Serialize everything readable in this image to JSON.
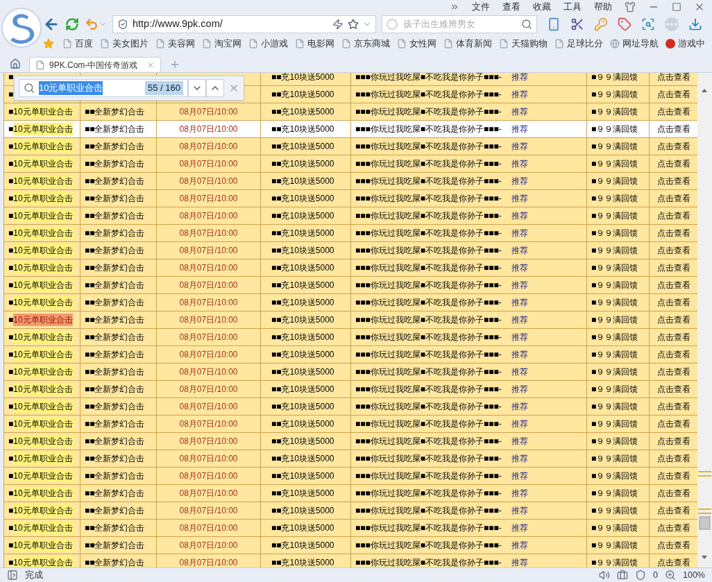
{
  "menu": [
    "文件",
    "查看",
    "收藏",
    "工具",
    "帮助"
  ],
  "address": {
    "url": "http://www.9pk.com/"
  },
  "search": {
    "placeholder": "孩子出生难辨男女"
  },
  "bookmarks": [
    {
      "label": "百度",
      "kind": "page"
    },
    {
      "label": "美女图片",
      "kind": "page"
    },
    {
      "label": "美容网",
      "kind": "page"
    },
    {
      "label": "淘宝网",
      "kind": "page"
    },
    {
      "label": "小游戏",
      "kind": "page"
    },
    {
      "label": "电影网",
      "kind": "page"
    },
    {
      "label": "京东商城",
      "kind": "page"
    },
    {
      "label": "女性网",
      "kind": "page"
    },
    {
      "label": "体育新闻",
      "kind": "page"
    },
    {
      "label": "天猫购物",
      "kind": "page"
    },
    {
      "label": "足球比分",
      "kind": "page"
    },
    {
      "label": "网址导航",
      "kind": "globe"
    },
    {
      "label": "游戏中",
      "kind": "game"
    }
  ],
  "tabs": [
    {
      "title": "9PK.Com-中国传奇游戏",
      "selected": true
    }
  ],
  "find_bar": {
    "query": "10元单职业合击",
    "count": "55 / 160"
  },
  "rows": [
    {
      "cells": [
        "■",
        null,
        null,
        null,
        "■■充10块送5000",
        "■■■你玩过我吃屎■不吃我是你孙子■■■-",
        "推荐",
        "■９９满回馈",
        "点击查看"
      ],
      "hovered": false
    },
    {
      "cells": [
        "■",
        null,
        null,
        null,
        "■■充10块送5000",
        "■■■你玩过我吃屎■不吃我是你孙子■■■-",
        "推荐",
        "■９９满回馈",
        "点击查看"
      ],
      "hovered": false
    },
    {
      "cells": [
        "■",
        "10元单职业合击",
        "■■全新梦幻合击",
        "08月07日/10:00",
        "■■充10块送5000",
        "■■■你玩过我吃屎■不吃我是你孙子■■■-",
        "推荐",
        "■９９满回馈",
        "点击查看"
      ],
      "hovered": false,
      "current_match": false
    },
    {
      "cells": [
        "■",
        "10元单职业合击",
        "■■全新梦幻合击",
        "08月07日/10:00",
        "■■充10块送5000",
        "■■■你玩过我吃屎■不吃我是你孙子■■■-",
        "推荐",
        "■９９满回馈",
        "点击查看"
      ],
      "hovered": true,
      "current_match": false
    },
    {
      "cells": [
        "■",
        "10元单职业合击",
        "■■全新梦幻合击",
        "08月07日/10:00",
        "■■充10块送5000",
        "■■■你玩过我吃屎■不吃我是你孙子■■■-",
        "推荐",
        "■９９满回馈",
        "点击查看"
      ],
      "hovered": false,
      "current_match": false
    },
    {
      "cells": [
        "■",
        "10元单职业合击",
        "■■全新梦幻合击",
        "08月07日/10:00",
        "■■充10块送5000",
        "■■■你玩过我吃屎■不吃我是你孙子■■■-",
        "推荐",
        "■９９满回馈",
        "点击查看"
      ],
      "hovered": false,
      "current_match": false
    },
    {
      "cells": [
        "■",
        "10元单职业合击",
        "■■全新梦幻合击",
        "08月07日/10:00",
        "■■充10块送5000",
        "■■■你玩过我吃屎■不吃我是你孙子■■■-",
        "推荐",
        "■９９满回馈",
        "点击查看"
      ],
      "hovered": false,
      "current_match": false
    },
    {
      "cells": [
        "■",
        "10元单职业合击",
        "■■全新梦幻合击",
        "08月07日/10:00",
        "■■充10块送5000",
        "■■■你玩过我吃屎■不吃我是你孙子■■■-",
        "推荐",
        "■９９满回馈",
        "点击查看"
      ],
      "hovered": false,
      "current_match": false
    },
    {
      "cells": [
        "■",
        "10元单职业合击",
        "■■全新梦幻合击",
        "08月07日/10:00",
        "■■充10块送5000",
        "■■■你玩过我吃屎■不吃我是你孙子■■■-",
        "推荐",
        "■９９满回馈",
        "点击查看"
      ],
      "hovered": false,
      "current_match": false
    },
    {
      "cells": [
        "■",
        "10元单职业合击",
        "■■全新梦幻合击",
        "08月07日/10:00",
        "■■充10块送5000",
        "■■■你玩过我吃屎■不吃我是你孙子■■■-",
        "推荐",
        "■９９满回馈",
        "点击查看"
      ],
      "hovered": false,
      "current_match": false
    },
    {
      "cells": [
        "■",
        "10元单职业合击",
        "■■全新梦幻合击",
        "08月07日/10:00",
        "■■充10块送5000",
        "■■■你玩过我吃屎■不吃我是你孙子■■■-",
        "推荐",
        "■９９满回馈",
        "点击查看"
      ],
      "hovered": false,
      "current_match": false
    },
    {
      "cells": [
        "■",
        "10元单职业合击",
        "■■全新梦幻合击",
        "08月07日/10:00",
        "■■充10块送5000",
        "■■■你玩过我吃屎■不吃我是你孙子■■■-",
        "推荐",
        "■９９满回馈",
        "点击查看"
      ],
      "hovered": false,
      "current_match": false
    },
    {
      "cells": [
        "■",
        "10元单职业合击",
        "■■全新梦幻合击",
        "08月07日/10:00",
        "■■充10块送5000",
        "■■■你玩过我吃屎■不吃我是你孙子■■■-",
        "推荐",
        "■９９满回馈",
        "点击查看"
      ],
      "hovered": false,
      "current_match": false
    },
    {
      "cells": [
        "■",
        "10元单职业合击",
        "■■全新梦幻合击",
        "08月07日/10:00",
        "■■充10块送5000",
        "■■■你玩过我吃屎■不吃我是你孙子■■■-",
        "推荐",
        "■９９满回馈",
        "点击查看"
      ],
      "hovered": false,
      "current_match": false
    },
    {
      "cells": [
        "■",
        "10元单职业合击",
        "■■全新梦幻合击",
        "08月07日/10:00",
        "■■充10块送5000",
        "■■■你玩过我吃屎■不吃我是你孙子■■■-",
        "推荐",
        "■９９满回馈",
        "点击查看"
      ],
      "hovered": false,
      "current_match": true
    },
    {
      "cells": [
        "■",
        "10元单职业合击",
        "■■全新梦幻合击",
        "08月07日/10:00",
        "■■充10块送5000",
        "■■■你玩过我吃屎■不吃我是你孙子■■■-",
        "推荐",
        "■９９满回馈",
        "点击查看"
      ],
      "hovered": false,
      "current_match": false
    },
    {
      "cells": [
        "■",
        "10元单职业合击",
        "■■全新梦幻合击",
        "08月07日/10:00",
        "■■充10块送5000",
        "■■■你玩过我吃屎■不吃我是你孙子■■■-",
        "推荐",
        "■９９满回馈",
        "点击查看"
      ],
      "hovered": false,
      "current_match": false
    },
    {
      "cells": [
        "■",
        "10元单职业合击",
        "■■全新梦幻合击",
        "08月07日/10:00",
        "■■充10块送5000",
        "■■■你玩过我吃屎■不吃我是你孙子■■■-",
        "推荐",
        "■９９满回馈",
        "点击查看"
      ],
      "hovered": false,
      "current_match": false
    },
    {
      "cells": [
        "■",
        "10元单职业合击",
        "■■全新梦幻合击",
        "08月07日/10:00",
        "■■充10块送5000",
        "■■■你玩过我吃屎■不吃我是你孙子■■■-",
        "推荐",
        "■９９满回馈",
        "点击查看"
      ],
      "hovered": false,
      "current_match": false
    },
    {
      "cells": [
        "■",
        "10元单职业合击",
        "■■全新梦幻合击",
        "08月07日/10:00",
        "■■充10块送5000",
        "■■■你玩过我吃屎■不吃我是你孙子■■■-",
        "推荐",
        "■９９满回馈",
        "点击查看"
      ],
      "hovered": false,
      "current_match": false
    },
    {
      "cells": [
        "■",
        "10元单职业合击",
        "■■全新梦幻合击",
        "08月07日/10:00",
        "■■充10块送5000",
        "■■■你玩过我吃屎■不吃我是你孙子■■■-",
        "推荐",
        "■９９满回馈",
        "点击查看"
      ],
      "hovered": false,
      "current_match": false
    },
    {
      "cells": [
        "■",
        "10元单职业合击",
        "■■全新梦幻合击",
        "08月07日/10:00",
        "■■充10块送5000",
        "■■■你玩过我吃屎■不吃我是你孙子■■■-",
        "推荐",
        "■９９满回馈",
        "点击查看"
      ],
      "hovered": false,
      "current_match": false
    },
    {
      "cells": [
        "■",
        "10元单职业合击",
        "■■全新梦幻合击",
        "08月07日/10:00",
        "■■充10块送5000",
        "■■■你玩过我吃屎■不吃我是你孙子■■■-",
        "推荐",
        "■９９满回馈",
        "点击查看"
      ],
      "hovered": false,
      "current_match": false
    },
    {
      "cells": [
        "■",
        "10元单职业合击",
        "■■全新梦幻合击",
        "08月07日/10:00",
        "■■充10块送5000",
        "■■■你玩过我吃屎■不吃我是你孙子■■■-",
        "推荐",
        "■９９满回馈",
        "点击查看"
      ],
      "hovered": false,
      "current_match": false
    },
    {
      "cells": [
        "■",
        "10元单职业合击",
        "■■全新梦幻合击",
        "08月07日/10:00",
        "■■充10块送5000",
        "■■■你玩过我吃屎■不吃我是你孙子■■■-",
        "推荐",
        "■９９满回馈",
        "点击查看"
      ],
      "hovered": false,
      "current_match": false
    },
    {
      "cells": [
        "■",
        "10元单职业合击",
        "■■全新梦幻合击",
        "08月07日/10:00",
        "■■充10块送5000",
        "■■■你玩过我吃屎■不吃我是你孙子■■■-",
        "推荐",
        "■９９满回馈",
        "点击查看"
      ],
      "hovered": false,
      "current_match": false
    },
    {
      "cells": [
        "■",
        "10元单职业合击",
        "■■全新梦幻合击",
        "08月07日/10:00",
        "■■充10块送5000",
        "■■■你玩过我吃屎■不吃我是你孙子■■■-",
        "推荐",
        "■９９满回馈",
        "点击查看"
      ],
      "hovered": false,
      "current_match": false
    },
    {
      "cells": [
        "■",
        "10元单职业合击",
        "■■全新梦幻合击",
        "08月07日/10:00",
        "■■充10块送5000",
        "■■■你玩过我吃屎■不吃我是你孙子■■■-",
        "推荐",
        "■９９满回馈",
        "点击查看"
      ],
      "hovered": false,
      "current_match": false
    },
    {
      "cells": [
        "■",
        "10元单职业合击",
        "■■全新梦幻合击",
        "08月07日/10:00",
        "■■充10块送5000",
        "■■■你玩过我吃屎■不吃我是你孙子■■■-",
        "推荐",
        "■９９满回馈",
        "点击查看"
      ],
      "hovered": false,
      "current_match": false
    }
  ],
  "status_bar": {
    "text": "完成",
    "blocked": "0",
    "zoom": "100%"
  }
}
